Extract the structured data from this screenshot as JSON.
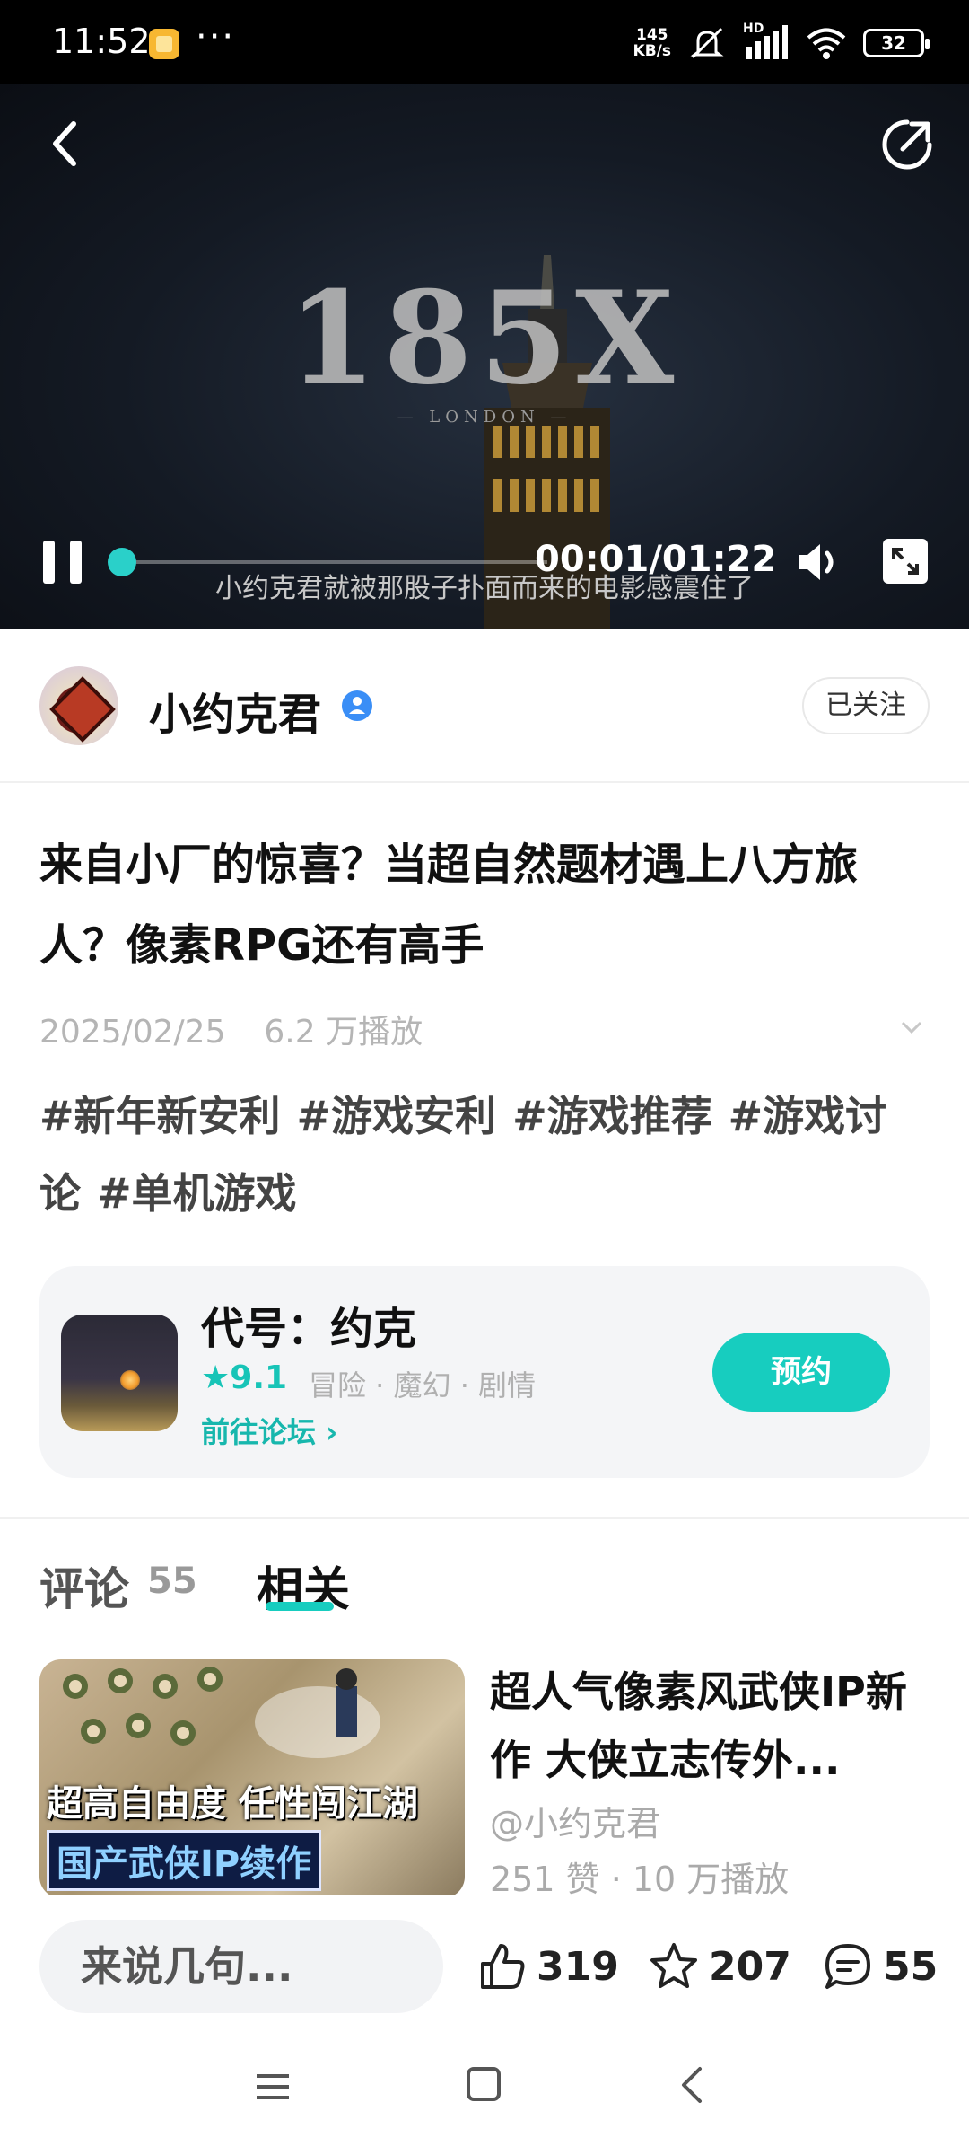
{
  "status_bar": {
    "time": "11:52",
    "dots": "···",
    "speed_value": "145",
    "speed_unit": "KB/s",
    "network_label": "HD",
    "battery": "32"
  },
  "video": {
    "title_text": "185X",
    "subtitle_text": "— LONDON —",
    "time": "00:01/01:22",
    "caption": "小约克君就被那股子扑面而来的电影感震住了",
    "progress_fraction": 0.012
  },
  "author": {
    "name": "小约克君",
    "follow_label": "已关注"
  },
  "post": {
    "title": "来自小厂的惊喜？当超自然题材遇上八方旅人？像素RPG还有高手",
    "date": "2025/02/25",
    "plays": "6.2 万播放",
    "tags": [
      "#新年新安利",
      "#游戏安利",
      "#游戏推荐",
      "#游戏讨论",
      "#单机游戏"
    ]
  },
  "game": {
    "name": "代号：约克",
    "rating": "★9.1",
    "genres": "冒险 · 魔幻 · 剧情",
    "forum_link": "前往论坛 ›",
    "reserve_label": "预约"
  },
  "tabs": {
    "comments_label": "评论",
    "comments_count": "55",
    "related_label": "相关"
  },
  "related": [
    {
      "title": "超人气像素风武侠IP新作 大侠立志传外...",
      "author": "@小约克君",
      "stats": "251 赞 · 10 万播放",
      "thumb_line1": "超高自由度 任性闯江湖",
      "thumb_line2": "国产武侠IP续作"
    }
  ],
  "bottom_bar": {
    "comment_placeholder": "来说几句...",
    "likes": "319",
    "favorites": "207",
    "comments": "55"
  },
  "icons": {
    "accent": "#17cdbf"
  }
}
